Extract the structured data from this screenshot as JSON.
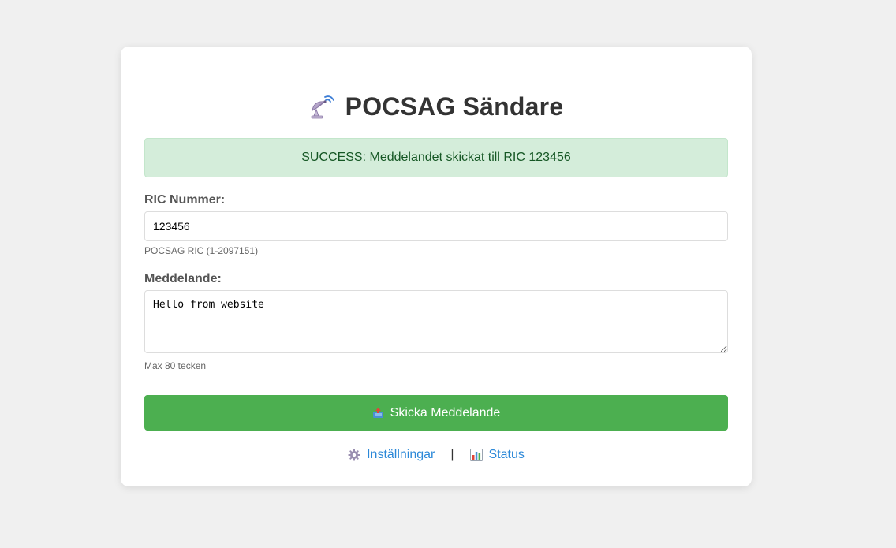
{
  "header": {
    "title": "POCSAG Sändare",
    "icon": "satellite-antenna-icon"
  },
  "alert": {
    "text": "SUCCESS: Meddelandet skickat till RIC 123456",
    "bg_color": "#d4edda",
    "text_color": "#155724"
  },
  "form": {
    "ric_label": "RIC Nummer:",
    "ric_value": "123456",
    "ric_help": "POCSAG RIC (1-2097151)",
    "message_label": "Meddelande:",
    "message_value": "Hello from website",
    "message_help": "Max 80 tecken",
    "submit_label": "Skicka Meddelande",
    "submit_icon": "outbox-tray-icon",
    "submit_color": "#4caf50"
  },
  "footer": {
    "settings_label": "Inställningar",
    "settings_icon": "gear-icon",
    "separator": "|",
    "status_label": "Status",
    "status_icon": "bar-chart-icon",
    "link_color": "#2b88d8"
  }
}
